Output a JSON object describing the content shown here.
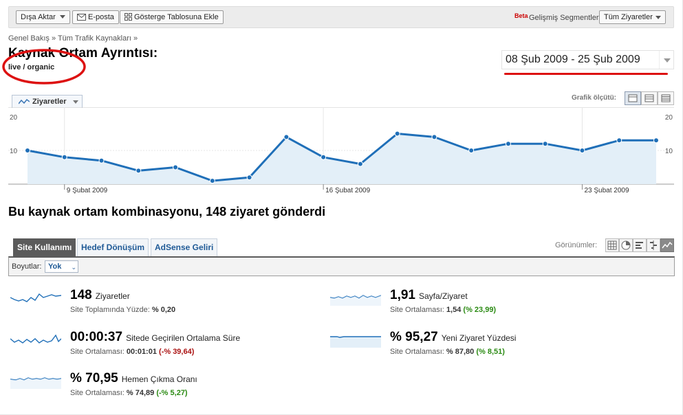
{
  "toolbar": {
    "export_label": "Dışa Aktar",
    "email_label": "E-posta",
    "dashboard_label": "Gösterge Tablosuna Ekle",
    "beta_label": "Beta",
    "segments_label": "Gelişmiş Segmentler:",
    "segments_value": "Tüm Ziyaretler"
  },
  "breadcrumb": "Genel Bakış » Tüm Trafik Kaynakları »",
  "page": {
    "title": "Kaynak Ortam Ayrıntısı:",
    "subtitle": "live / organic",
    "date_range": "08 Şub 2009 - 25 Şub 2009"
  },
  "chart_header": {
    "metric_label": "Ziyaretler",
    "mode_label": "Grafik ölçütü:"
  },
  "chart_data": {
    "type": "area",
    "x": [
      "2009-02-08",
      "2009-02-09",
      "2009-02-10",
      "2009-02-11",
      "2009-02-12",
      "2009-02-13",
      "2009-02-14",
      "2009-02-15",
      "2009-02-16",
      "2009-02-17",
      "2009-02-18",
      "2009-02-19",
      "2009-02-20",
      "2009-02-21",
      "2009-02-22",
      "2009-02-23",
      "2009-02-24",
      "2009-02-25"
    ],
    "values": [
      10,
      8,
      7,
      4,
      5,
      1,
      2,
      14,
      8,
      6,
      15,
      14,
      10,
      12,
      12,
      10,
      13,
      13
    ],
    "y_ticks": [
      "10",
      "20"
    ],
    "ylim": [
      0,
      20
    ],
    "x_tick_labels": [
      "9 Şubat 2009",
      "16 Şubat 2009",
      "23 Şubat 2009"
    ],
    "series_color": "#1f6fb8",
    "fill_color": "#e3eff8",
    "grid": true
  },
  "headline": "Bu kaynak ortam kombinasyonu, 148 ziyaret gönderdi",
  "tabs": [
    "Site Kullanımı",
    "Hedef Dönüşüm",
    "AdSense Geliri"
  ],
  "views_label": "Görünümler:",
  "dimension": {
    "label": "Boyutlar:",
    "value": "Yok"
  },
  "metrics": [
    {
      "value": "148",
      "name": "Ziyaretler",
      "sub_label": "Site Toplamında Yüzde:",
      "sub_value": "% 0,20",
      "delta": "",
      "delta_sign": ""
    },
    {
      "value": "1,91",
      "name": "Sayfa/Ziyaret",
      "sub_label": "Site Ortalaması:",
      "sub_value": "1,54",
      "delta": "(% 23,99)",
      "delta_sign": "pos"
    },
    {
      "value": "00:00:37",
      "name": "Sitede Geçirilen Ortalama Süre",
      "sub_label": "Site Ortalaması:",
      "sub_value": "00:01:01",
      "delta": "(-% 39,64)",
      "delta_sign": "neg"
    },
    {
      "value": "% 95,27",
      "name": "Yeni Ziyaret Yüzdesi",
      "sub_label": "Site Ortalaması:",
      "sub_value": "% 87,80",
      "delta": "(% 8,51)",
      "delta_sign": "pos"
    },
    {
      "value": "% 70,95",
      "name": "Hemen Çıkma Oranı",
      "sub_label": "Site Ortalaması:",
      "sub_value": "% 74,89",
      "delta": "(-% 5,27)",
      "delta_sign": "pos"
    }
  ]
}
